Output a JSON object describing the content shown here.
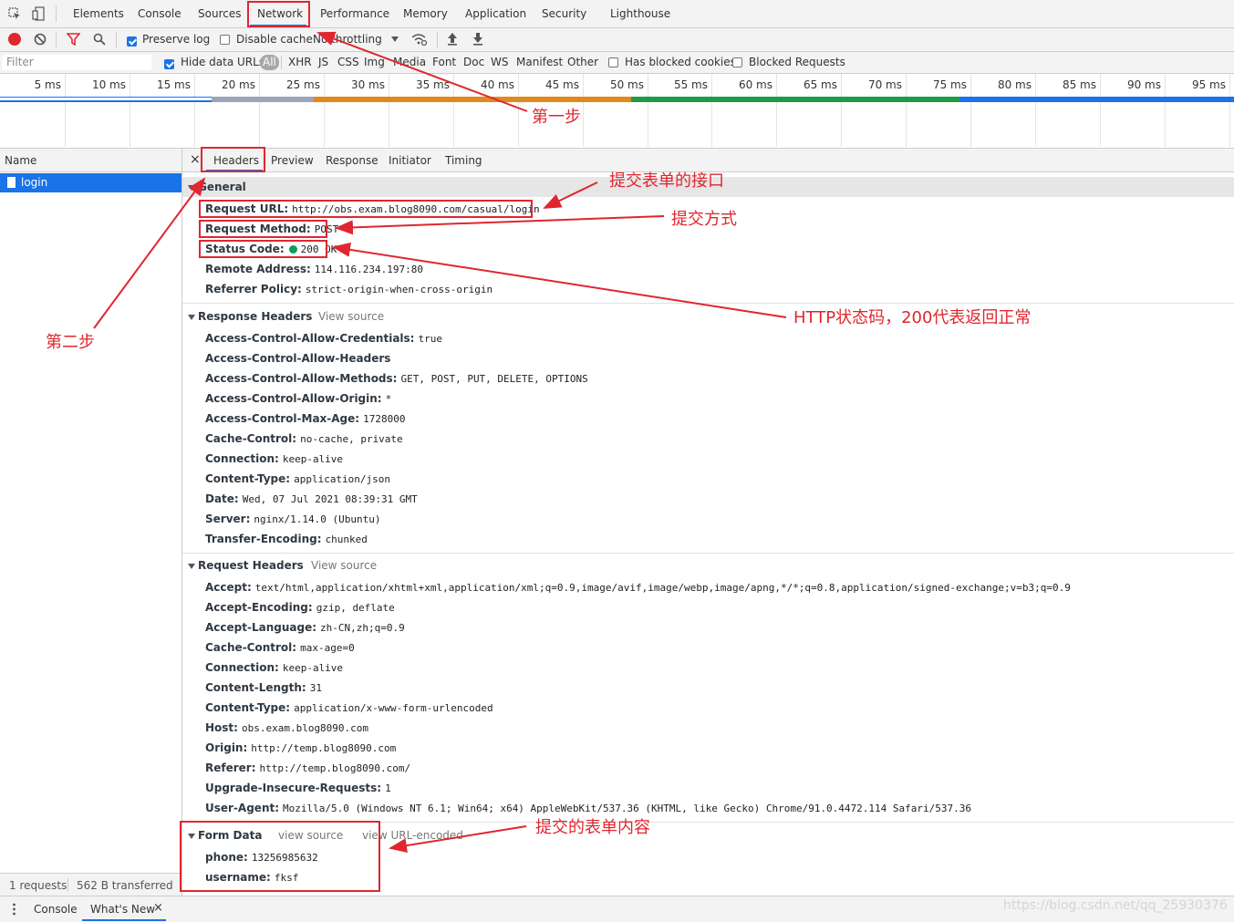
{
  "tabs": {
    "items": [
      {
        "label": "Elements"
      },
      {
        "label": "Console"
      },
      {
        "label": "Sources"
      },
      {
        "label": "Network"
      },
      {
        "label": "Performance"
      },
      {
        "label": "Memory"
      },
      {
        "label": "Application"
      },
      {
        "label": "Security"
      },
      {
        "label": "Lighthouse"
      }
    ],
    "active": "Network"
  },
  "toolbar": {
    "preserve_log": "Preserve log",
    "disable_cache": "Disable cache",
    "throttling": "No throttling"
  },
  "filterbar": {
    "placeholder": "Filter",
    "hide_data_urls": "Hide data URLs",
    "types": [
      "All",
      "XHR",
      "JS",
      "CSS",
      "Img",
      "Media",
      "Font",
      "Doc",
      "WS",
      "Manifest",
      "Other"
    ],
    "has_blocked_cookies": "Has blocked cookies",
    "blocked_requests": "Blocked Requests"
  },
  "timeline": {
    "ticks": [
      "5 ms",
      "10 ms",
      "15 ms",
      "20 ms",
      "25 ms",
      "30 ms",
      "35 ms",
      "40 ms",
      "45 ms",
      "50 ms",
      "55 ms",
      "60 ms",
      "65 ms",
      "70 ms",
      "75 ms",
      "80 ms",
      "85 ms",
      "90 ms",
      "95 ms"
    ]
  },
  "requests": {
    "column_name": "Name",
    "items": [
      {
        "name": "login"
      }
    ],
    "footer_count": "1 requests",
    "footer_transferred": "562 B transferred"
  },
  "detail_tabs": [
    "Headers",
    "Preview",
    "Response",
    "Initiator",
    "Timing"
  ],
  "general": {
    "title": "General",
    "rows": [
      {
        "k": "Request URL:",
        "v": "http://obs.exam.blog8090.com/casual/login"
      },
      {
        "k": "Request Method:",
        "v": "POST"
      },
      {
        "k": "Status Code:",
        "v": "200 OK"
      },
      {
        "k": "Remote Address:",
        "v": "114.116.234.197:80"
      },
      {
        "k": "Referrer Policy:",
        "v": "strict-origin-when-cross-origin"
      }
    ]
  },
  "response_headers": {
    "title": "Response Headers",
    "view_source": "View source",
    "rows": [
      {
        "k": "Access-Control-Allow-Credentials:",
        "v": "true"
      },
      {
        "k": "Access-Control-Allow-Headers",
        "v": ""
      },
      {
        "k": "Access-Control-Allow-Methods:",
        "v": "GET, POST, PUT, DELETE, OPTIONS"
      },
      {
        "k": "Access-Control-Allow-Origin:",
        "v": "*"
      },
      {
        "k": "Access-Control-Max-Age:",
        "v": "1728000"
      },
      {
        "k": "Cache-Control:",
        "v": "no-cache, private"
      },
      {
        "k": "Connection:",
        "v": "keep-alive"
      },
      {
        "k": "Content-Type:",
        "v": "application/json"
      },
      {
        "k": "Date:",
        "v": "Wed, 07 Jul 2021 08:39:31 GMT"
      },
      {
        "k": "Server:",
        "v": "nginx/1.14.0 (Ubuntu)"
      },
      {
        "k": "Transfer-Encoding:",
        "v": "chunked"
      }
    ]
  },
  "request_headers": {
    "title": "Request Headers",
    "view_source": "View source",
    "rows": [
      {
        "k": "Accept:",
        "v": "text/html,application/xhtml+xml,application/xml;q=0.9,image/avif,image/webp,image/apng,*/*;q=0.8,application/signed-exchange;v=b3;q=0.9"
      },
      {
        "k": "Accept-Encoding:",
        "v": "gzip, deflate"
      },
      {
        "k": "Accept-Language:",
        "v": "zh-CN,zh;q=0.9"
      },
      {
        "k": "Cache-Control:",
        "v": "max-age=0"
      },
      {
        "k": "Connection:",
        "v": "keep-alive"
      },
      {
        "k": "Content-Length:",
        "v": "31"
      },
      {
        "k": "Content-Type:",
        "v": "application/x-www-form-urlencoded"
      },
      {
        "k": "Host:",
        "v": "obs.exam.blog8090.com"
      },
      {
        "k": "Origin:",
        "v": "http://temp.blog8090.com"
      },
      {
        "k": "Referer:",
        "v": "http://temp.blog8090.com/"
      },
      {
        "k": "Upgrade-Insecure-Requests:",
        "v": "1"
      },
      {
        "k": "User-Agent:",
        "v": "Mozilla/5.0 (Windows NT 6.1; Win64; x64) AppleWebKit/537.36 (KHTML, like Gecko) Chrome/91.0.4472.114 Safari/537.36"
      }
    ]
  },
  "form_data": {
    "title": "Form Data",
    "view_source": "view source",
    "view_url_encoded": "view URL-encoded",
    "rows": [
      {
        "k": "phone:",
        "v": "13256985632"
      },
      {
        "k": "username:",
        "v": "fksf"
      }
    ]
  },
  "drawer": {
    "console": "Console",
    "whats_new": "What's New"
  },
  "annotations": {
    "step1": "第一步",
    "step2": "第二步",
    "submit_url": "提交表单的接口",
    "submit_method": "提交方式",
    "status_note": "HTTP状态码，200代表返回正常",
    "form_content": "提交的表单内容"
  },
  "watermark": "https://blog.csdn.net/qq_25930376",
  "colors": {
    "accent": "#1a73e8",
    "annotation_red": "#e0262e",
    "status_green": "#0f9d58"
  }
}
